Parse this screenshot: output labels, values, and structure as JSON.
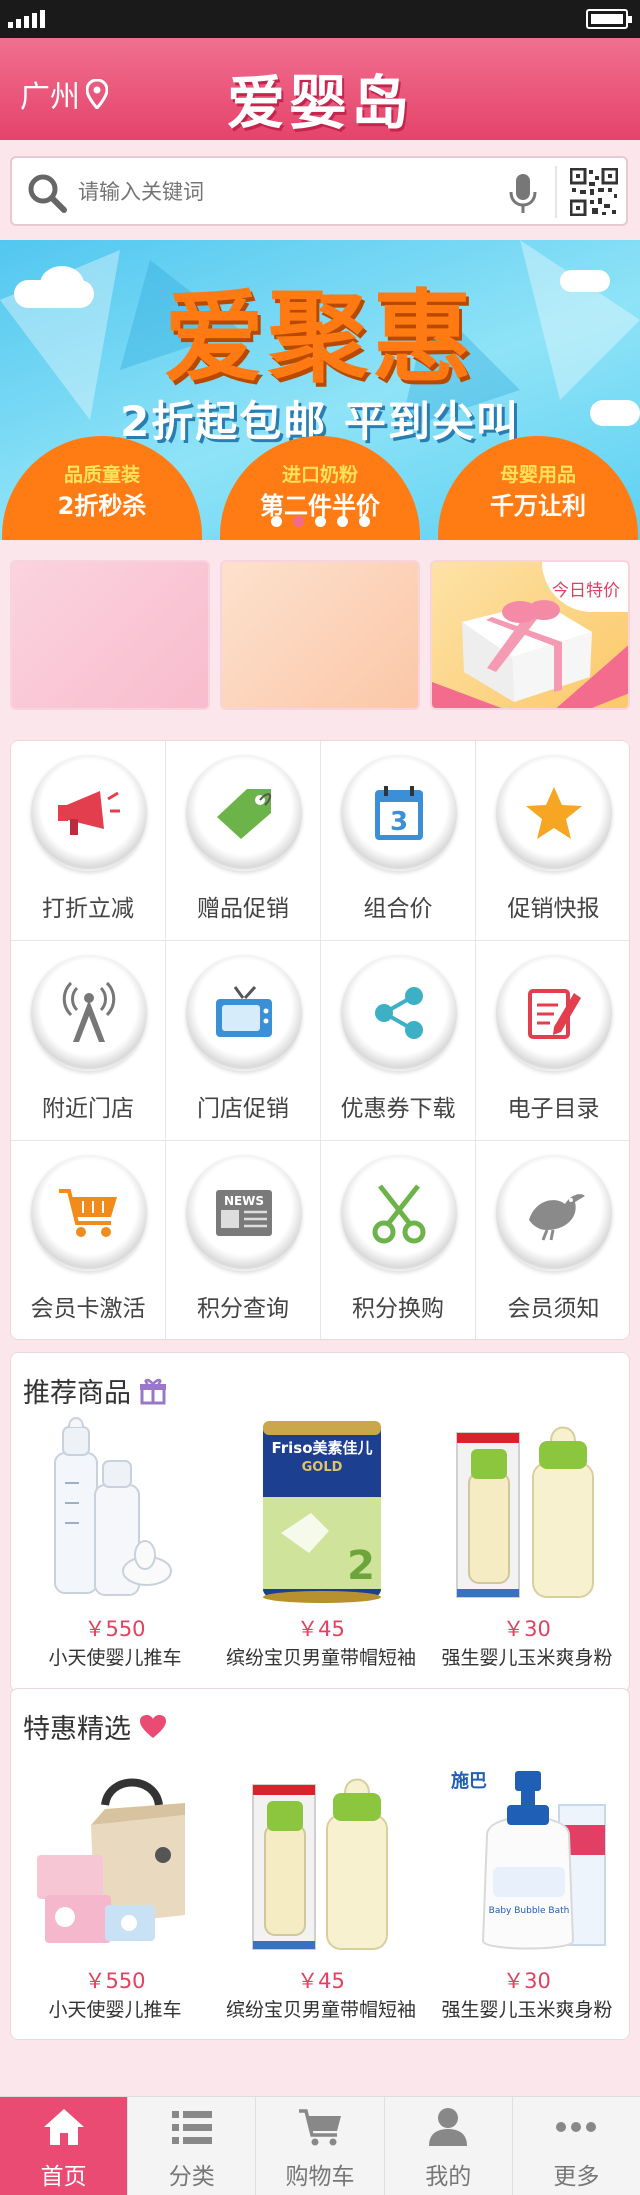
{
  "header": {
    "city": "广州",
    "logo_text": "爱婴岛"
  },
  "search": {
    "placeholder": "请输入关键词"
  },
  "banner": {
    "title": "爱聚惠",
    "subtitle": "2折起包邮 平到尖叫",
    "tabs": [
      {
        "line1": "品质童装",
        "line2": "2折秒杀"
      },
      {
        "line1": "进口奶粉",
        "line2": "第二件半价"
      },
      {
        "line1": "母婴用品",
        "line2": "千万让利"
      }
    ],
    "dot_count": 5,
    "active_dot": 1
  },
  "promos": {
    "badge": "今日特价"
  },
  "features": [
    {
      "label": "打折立减",
      "icon": "megaphone-icon"
    },
    {
      "label": "赠品促销",
      "icon": "tag-icon"
    },
    {
      "label": "组合价",
      "icon": "calendar-icon",
      "icon_text": "3"
    },
    {
      "label": "促销快报",
      "icon": "star-icon"
    },
    {
      "label": "附近门店",
      "icon": "antenna-icon"
    },
    {
      "label": "门店促销",
      "icon": "tv-icon"
    },
    {
      "label": "优惠券下载",
      "icon": "share-icon"
    },
    {
      "label": "电子目录",
      "icon": "document-edit-icon"
    },
    {
      "label": "会员卡激活",
      "icon": "cart-icon"
    },
    {
      "label": "积分查询",
      "icon": "news-icon",
      "icon_text": "NEWS"
    },
    {
      "label": "积分换购",
      "icon": "scissors-icon"
    },
    {
      "label": "会员须知",
      "icon": "bird-icon"
    }
  ],
  "recommended": {
    "title": "推荐商品",
    "products": [
      {
        "price": "￥550",
        "name": "小天使婴儿推车",
        "image": "baby-bottles"
      },
      {
        "price": "￥45",
        "name": "缤纷宝贝男童带帽短袖",
        "image": "formula-can",
        "brand": "Friso美素佳儿",
        "brand_sub": "GOLD"
      },
      {
        "price": "￥30",
        "name": "强生婴儿玉米爽身粉",
        "image": "pigeon-bottles"
      }
    ]
  },
  "specials": {
    "title": "特惠精选",
    "products": [
      {
        "price": "￥550",
        "name": "小天使婴儿推车",
        "image": "diaper-bag"
      },
      {
        "price": "￥45",
        "name": "缤纷宝贝男童带帽短袖",
        "image": "pigeon-bottles"
      },
      {
        "price": "￥30",
        "name": "强生婴儿玉米爽身粉",
        "image": "sebamed-bath",
        "brand": "施巴",
        "brand_sub": "Baby Bubble Bath"
      }
    ]
  },
  "tabbar": [
    {
      "label": "首页",
      "icon": "home-icon",
      "active": true
    },
    {
      "label": "分类",
      "icon": "list-icon",
      "active": false
    },
    {
      "label": "购物车",
      "icon": "cart-icon",
      "active": false
    },
    {
      "label": "我的",
      "icon": "user-icon",
      "active": false
    },
    {
      "label": "更多",
      "icon": "more-icon",
      "active": false
    }
  ],
  "colors": {
    "brand": "#e94b72",
    "price": "#e4405f",
    "banner_orange": "#ff7c15"
  }
}
